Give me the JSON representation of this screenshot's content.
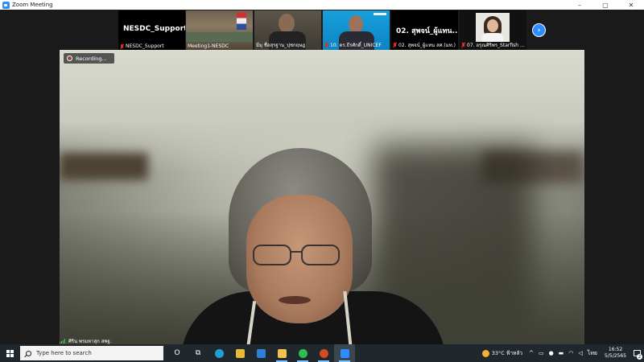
{
  "window": {
    "title": "Zoom Meeting",
    "minimize_glyph": "–",
    "maximize_glyph": "▢",
    "close_glyph": "✕"
  },
  "participants": [
    {
      "big_name": "NESDC_Support",
      "label": "NESDC_Support",
      "scene": "name-only"
    },
    {
      "big_name": "",
      "label": "Meeting1-NESDC",
      "scene": "room"
    },
    {
      "big_name": "",
      "label": "มิ่มุ ชื่อสุรฐาน_ปุชกฤษฎ",
      "scene": "man"
    },
    {
      "big_name": "",
      "label": "10. ดร.ธีรศักดิ์_UNICEF",
      "scene": "unicef"
    },
    {
      "big_name": "02. สุพจน์_ผู้แทน...",
      "label": "02. สุพจน์_ผู้แทน สศ.(มท.)",
      "scene": "name-only"
    },
    {
      "big_name": "",
      "label": "07. อรุณศิริพร_Starfish ...",
      "scene": "woman"
    }
  ],
  "strip": {
    "next_glyph": "›"
  },
  "main_video": {
    "recording_label": "Recording...",
    "speaker_name": "ศิริน พรมหาสุก สพฐ."
  },
  "taskbar": {
    "search_placeholder": "Type here to search",
    "icons": [
      {
        "name": "cortana-icon",
        "glyph": "O",
        "color": "#ffffff"
      },
      {
        "name": "task-view-icon",
        "glyph": "⧉",
        "color": "#ffffff"
      },
      {
        "name": "edge-icon",
        "glyph": "",
        "color": "#1fa0d8"
      },
      {
        "name": "store-icon",
        "glyph": "",
        "color": "#e8b838"
      },
      {
        "name": "mail-icon",
        "glyph": "",
        "color": "#2f7fd8"
      },
      {
        "name": "file-explorer-icon",
        "glyph": "",
        "color": "#f2c24a"
      },
      {
        "name": "line-icon",
        "glyph": "",
        "color": "#2ebd4e"
      },
      {
        "name": "powerpoint-icon",
        "glyph": "",
        "color": "#d24a26"
      },
      {
        "name": "zoom-icon",
        "glyph": "",
        "color": "#2d8cff"
      }
    ],
    "weather": "33°C ฟ้าหลัว",
    "tray_chevron": "^",
    "language": "ไทย",
    "time": "16:52",
    "date": "5/5/2565",
    "notification_count": "2"
  }
}
